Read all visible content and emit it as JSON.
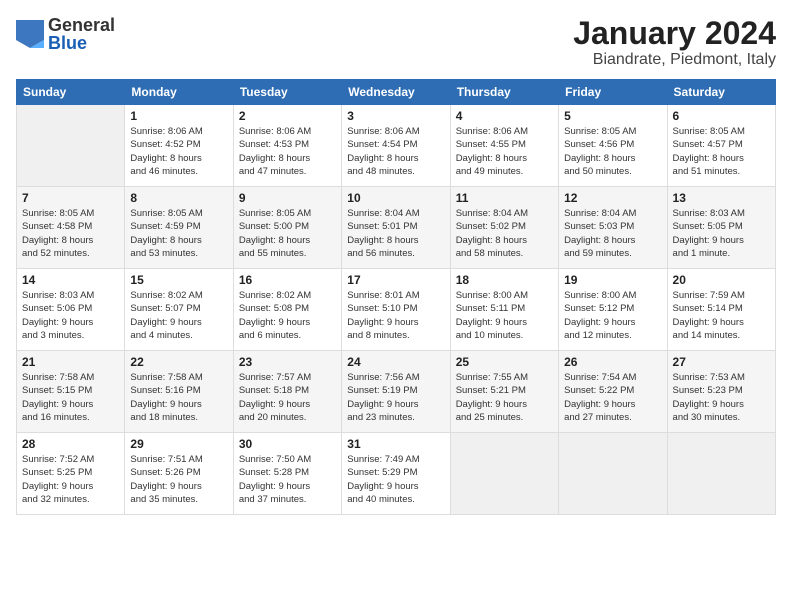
{
  "header": {
    "logo": {
      "general": "General",
      "blue": "Blue"
    },
    "title": "January 2024",
    "subtitle": "Biandrate, Piedmont, Italy"
  },
  "weekdays": [
    "Sunday",
    "Monday",
    "Tuesday",
    "Wednesday",
    "Thursday",
    "Friday",
    "Saturday"
  ],
  "weeks": [
    [
      {
        "day": "",
        "info": ""
      },
      {
        "day": "1",
        "info": "Sunrise: 8:06 AM\nSunset: 4:52 PM\nDaylight: 8 hours\nand 46 minutes."
      },
      {
        "day": "2",
        "info": "Sunrise: 8:06 AM\nSunset: 4:53 PM\nDaylight: 8 hours\nand 47 minutes."
      },
      {
        "day": "3",
        "info": "Sunrise: 8:06 AM\nSunset: 4:54 PM\nDaylight: 8 hours\nand 48 minutes."
      },
      {
        "day": "4",
        "info": "Sunrise: 8:06 AM\nSunset: 4:55 PM\nDaylight: 8 hours\nand 49 minutes."
      },
      {
        "day": "5",
        "info": "Sunrise: 8:05 AM\nSunset: 4:56 PM\nDaylight: 8 hours\nand 50 minutes."
      },
      {
        "day": "6",
        "info": "Sunrise: 8:05 AM\nSunset: 4:57 PM\nDaylight: 8 hours\nand 51 minutes."
      }
    ],
    [
      {
        "day": "7",
        "info": "Sunrise: 8:05 AM\nSunset: 4:58 PM\nDaylight: 8 hours\nand 52 minutes."
      },
      {
        "day": "8",
        "info": "Sunrise: 8:05 AM\nSunset: 4:59 PM\nDaylight: 8 hours\nand 53 minutes."
      },
      {
        "day": "9",
        "info": "Sunrise: 8:05 AM\nSunset: 5:00 PM\nDaylight: 8 hours\nand 55 minutes."
      },
      {
        "day": "10",
        "info": "Sunrise: 8:04 AM\nSunset: 5:01 PM\nDaylight: 8 hours\nand 56 minutes."
      },
      {
        "day": "11",
        "info": "Sunrise: 8:04 AM\nSunset: 5:02 PM\nDaylight: 8 hours\nand 58 minutes."
      },
      {
        "day": "12",
        "info": "Sunrise: 8:04 AM\nSunset: 5:03 PM\nDaylight: 8 hours\nand 59 minutes."
      },
      {
        "day": "13",
        "info": "Sunrise: 8:03 AM\nSunset: 5:05 PM\nDaylight: 9 hours\nand 1 minute."
      }
    ],
    [
      {
        "day": "14",
        "info": "Sunrise: 8:03 AM\nSunset: 5:06 PM\nDaylight: 9 hours\nand 3 minutes."
      },
      {
        "day": "15",
        "info": "Sunrise: 8:02 AM\nSunset: 5:07 PM\nDaylight: 9 hours\nand 4 minutes."
      },
      {
        "day": "16",
        "info": "Sunrise: 8:02 AM\nSunset: 5:08 PM\nDaylight: 9 hours\nand 6 minutes."
      },
      {
        "day": "17",
        "info": "Sunrise: 8:01 AM\nSunset: 5:10 PM\nDaylight: 9 hours\nand 8 minutes."
      },
      {
        "day": "18",
        "info": "Sunrise: 8:00 AM\nSunset: 5:11 PM\nDaylight: 9 hours\nand 10 minutes."
      },
      {
        "day": "19",
        "info": "Sunrise: 8:00 AM\nSunset: 5:12 PM\nDaylight: 9 hours\nand 12 minutes."
      },
      {
        "day": "20",
        "info": "Sunrise: 7:59 AM\nSunset: 5:14 PM\nDaylight: 9 hours\nand 14 minutes."
      }
    ],
    [
      {
        "day": "21",
        "info": "Sunrise: 7:58 AM\nSunset: 5:15 PM\nDaylight: 9 hours\nand 16 minutes."
      },
      {
        "day": "22",
        "info": "Sunrise: 7:58 AM\nSunset: 5:16 PM\nDaylight: 9 hours\nand 18 minutes."
      },
      {
        "day": "23",
        "info": "Sunrise: 7:57 AM\nSunset: 5:18 PM\nDaylight: 9 hours\nand 20 minutes."
      },
      {
        "day": "24",
        "info": "Sunrise: 7:56 AM\nSunset: 5:19 PM\nDaylight: 9 hours\nand 23 minutes."
      },
      {
        "day": "25",
        "info": "Sunrise: 7:55 AM\nSunset: 5:21 PM\nDaylight: 9 hours\nand 25 minutes."
      },
      {
        "day": "26",
        "info": "Sunrise: 7:54 AM\nSunset: 5:22 PM\nDaylight: 9 hours\nand 27 minutes."
      },
      {
        "day": "27",
        "info": "Sunrise: 7:53 AM\nSunset: 5:23 PM\nDaylight: 9 hours\nand 30 minutes."
      }
    ],
    [
      {
        "day": "28",
        "info": "Sunrise: 7:52 AM\nSunset: 5:25 PM\nDaylight: 9 hours\nand 32 minutes."
      },
      {
        "day": "29",
        "info": "Sunrise: 7:51 AM\nSunset: 5:26 PM\nDaylight: 9 hours\nand 35 minutes."
      },
      {
        "day": "30",
        "info": "Sunrise: 7:50 AM\nSunset: 5:28 PM\nDaylight: 9 hours\nand 37 minutes."
      },
      {
        "day": "31",
        "info": "Sunrise: 7:49 AM\nSunset: 5:29 PM\nDaylight: 9 hours\nand 40 minutes."
      },
      {
        "day": "",
        "info": ""
      },
      {
        "day": "",
        "info": ""
      },
      {
        "day": "",
        "info": ""
      }
    ]
  ]
}
